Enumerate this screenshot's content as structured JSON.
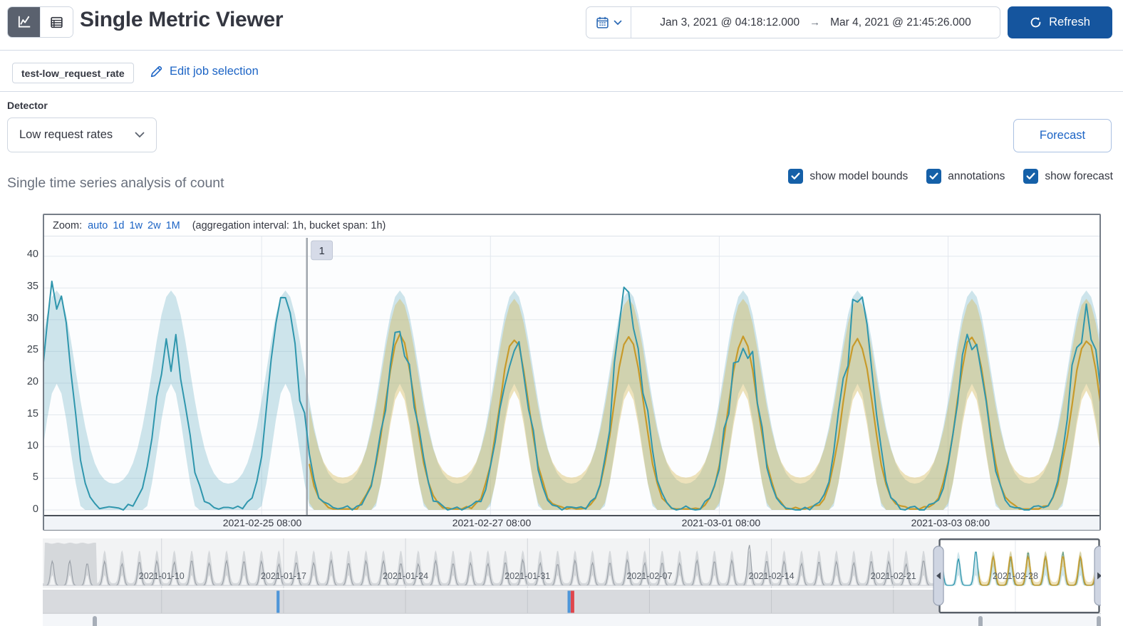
{
  "header": {
    "title": "Single Metric Viewer",
    "refresh_label": "Refresh",
    "time_range": {
      "start": "Jan 3, 2021 @ 04:18:12.000",
      "arrow": "→",
      "end": "Mar 4, 2021 @ 21:45:26.000"
    }
  },
  "job_bar": {
    "job_badge": "test-low_request_rate",
    "edit_link": "Edit job selection"
  },
  "detector": {
    "label": "Detector",
    "selected": "Low request rates"
  },
  "forecast_button_label": "Forecast",
  "series_heading": "Single time series analysis of count",
  "toggles": [
    {
      "label": "show model bounds",
      "checked": true
    },
    {
      "label": "annotations",
      "checked": true
    },
    {
      "label": "show forecast",
      "checked": true
    }
  ],
  "zoom_bar": {
    "prefix": "Zoom:",
    "options": [
      "auto",
      "1d",
      "1w",
      "2w",
      "1M"
    ],
    "suffix": "(aggregation interval: 1h, bucket span: 1h)"
  },
  "colors": {
    "link_blue": "#1C64C5",
    "button_blue": "#15559E",
    "checkbox_blue": "#1560a8",
    "actual_line": "#2F96AD",
    "model_bounds_fill": "rgba(82,164,187,0.28)",
    "forecast_line": "#C79A2A",
    "forecast_fill": "rgba(214,181,80,0.38)",
    "context_line": "#9ba1a8",
    "context_band": "#dfe1e4",
    "anomaly_minor": "#4e95d8",
    "anomaly_critical": "#e0464c",
    "annotation_badge_bg": "#d6dbe8",
    "gridline": "#e3e8ee"
  },
  "chart_data": {
    "type": "line",
    "focus": {
      "y_ticks": [
        0,
        5,
        10,
        15,
        20,
        25,
        30,
        35,
        40
      ],
      "ylim": [
        0,
        43
      ],
      "x_ticks": [
        {
          "label": "2021-02-25 08:00",
          "hour": 46
        },
        {
          "label": "2021-02-27 08:00",
          "hour": 94
        },
        {
          "label": "2021-03-01 08:00",
          "hour": 142
        },
        {
          "label": "2021-03-03 08:00",
          "hour": 190
        }
      ],
      "hours_total": 222,
      "day_peak_hours": [
        -21,
        3,
        27,
        51,
        75,
        99,
        123,
        147,
        171,
        195,
        219
      ],
      "actual_day_peaks": [
        30,
        35,
        27,
        35,
        29,
        27,
        34,
        28,
        34,
        27,
        33
      ],
      "forecast_peak_hours": [
        51,
        75,
        99,
        123,
        147,
        171,
        195,
        219
      ],
      "forecast_day_peaks": [
        27,
        27.5,
        27,
        27.5,
        27,
        27,
        27.5,
        27
      ],
      "forecast_start_h": 56,
      "annotation": {
        "label": "1",
        "hour": 55.5
      },
      "series_names": [
        "actual",
        "model bounds",
        "forecast",
        "forecast bounds"
      ],
      "noise_seed": 11
    },
    "context": {
      "days_total": 60.73,
      "tick_first_day": 6.82,
      "tick_interval_days": 7,
      "tick_labels": [
        "2021-01-10",
        "2021-01-17",
        "2021-01-24",
        "2021-01-31",
        "2021-02-07",
        "2021-02-14",
        "2021-02-21",
        "2021-02-28"
      ],
      "line_peak_default": 22,
      "band_peak_default": 31,
      "spike": {
        "day": 40,
        "peak": 38
      },
      "plateau_start_day": 0.1,
      "plateau_end_day": 3.1,
      "plateau_top": 39.5,
      "selection": {
        "start_day": 51.45,
        "end_day": 60.73
      },
      "forecast_start_day": 53.72,
      "selected_day_peaks": [
        35,
        27,
        35,
        29,
        27,
        34,
        28,
        34,
        27,
        33
      ],
      "selected_forecast_peaks": [
        27,
        27,
        27.5,
        27,
        27,
        27.5,
        27
      ],
      "noise_seed": 5
    },
    "swimlane": {
      "anomalies": [
        {
          "day": 13.42,
          "severity": "minor"
        },
        {
          "day": 30.12,
          "severity": "minor"
        },
        {
          "day": 30.3,
          "severity": "critical"
        }
      ]
    },
    "annotation_markers_days": [
      2.98,
      53.8,
      60.6
    ]
  }
}
